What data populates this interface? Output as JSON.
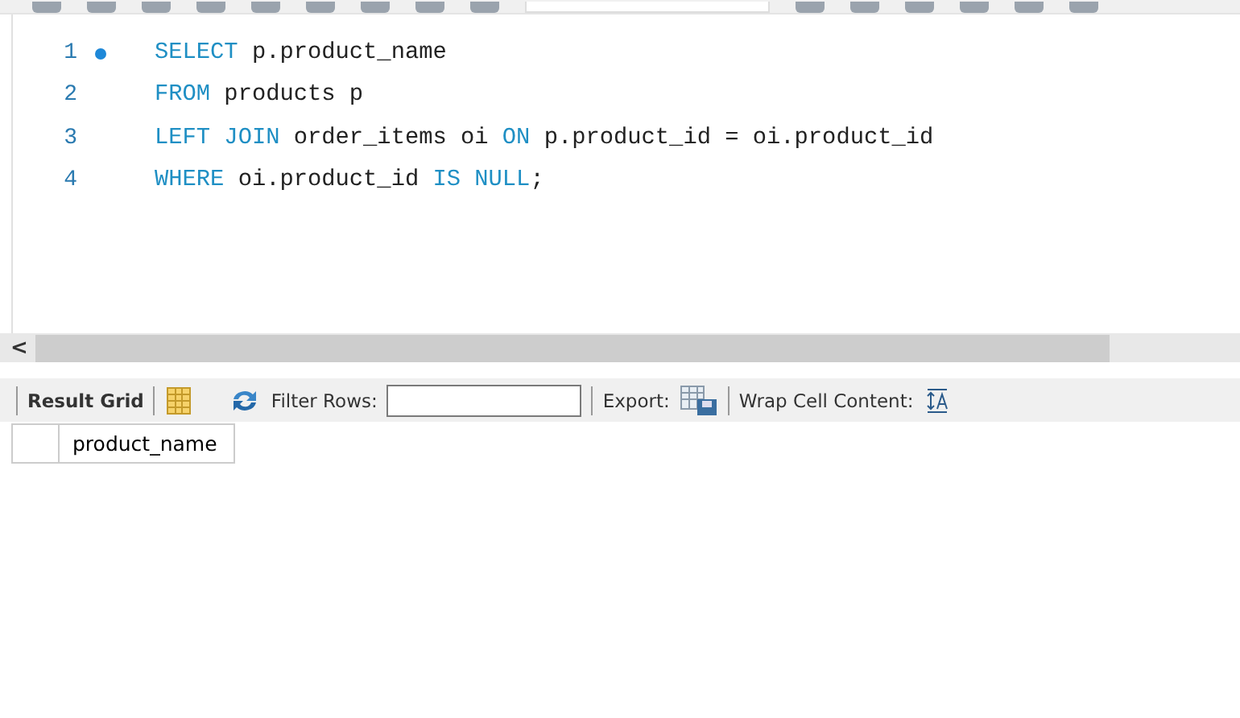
{
  "editor": {
    "lines": [
      {
        "number": "1",
        "marker": true,
        "tokens": [
          {
            "text": "SELECT",
            "kind": "keyword"
          },
          {
            "text": " p.product_name",
            "kind": "plain"
          }
        ]
      },
      {
        "number": "2",
        "marker": false,
        "tokens": [
          {
            "text": "FROM",
            "kind": "keyword"
          },
          {
            "text": " products p",
            "kind": "plain"
          }
        ]
      },
      {
        "number": "3",
        "marker": false,
        "tokens": [
          {
            "text": "LEFT JOIN",
            "kind": "keyword"
          },
          {
            "text": " order_items oi ",
            "kind": "plain"
          },
          {
            "text": "ON",
            "kind": "keyword"
          },
          {
            "text": " p.product_id = oi.product_id",
            "kind": "plain"
          }
        ]
      },
      {
        "number": "4",
        "marker": false,
        "tokens": [
          {
            "text": "WHERE",
            "kind": "keyword"
          },
          {
            "text": " oi.product_id ",
            "kind": "plain"
          },
          {
            "text": "IS NULL",
            "kind": "keyword"
          },
          {
            "text": ";",
            "kind": "plain"
          }
        ]
      }
    ]
  },
  "scrollbar": {
    "arrow": "<"
  },
  "result_toolbar": {
    "result_grid": "Result Grid",
    "filter_label": "Filter Rows:",
    "export_label": "Export:",
    "wrap_label": "Wrap Cell Content:"
  },
  "grid": {
    "columns": [
      "product_name"
    ]
  }
}
